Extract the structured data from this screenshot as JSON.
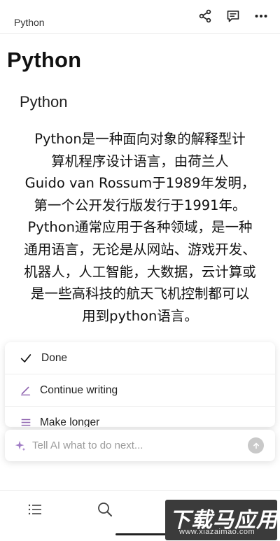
{
  "header": {
    "breadcrumb": "Python",
    "share_icon": "share-icon",
    "comment_icon": "comment-icon",
    "more_icon": "more-icon"
  },
  "document": {
    "title": "Python",
    "heading": "Python",
    "body_lines": [
      "Python是一种面向对象的解释型计",
      "算机程序设计语言，由荷兰人",
      "Guido van Rossum于1989年发明，",
      "第一个公开发行版发行于1991年。",
      "Python通常应用于各种领域，是一种",
      "通用语言，无论是从网站、游戏开发、",
      "机器人，人工智能，大数据，云计算或",
      "是一些高科技的航天飞机控制都可以",
      "用到python语言。"
    ]
  },
  "ai_menu": {
    "items": [
      {
        "label": "Done",
        "icon": "check-icon"
      },
      {
        "label": "Continue writing",
        "icon": "pen-icon"
      },
      {
        "label": "Make longer",
        "icon": "lines-icon"
      }
    ]
  },
  "ai_prompt": {
    "placeholder": "Tell AI what to do next...",
    "icon": "sparkle-icon",
    "send_icon": "send-icon"
  },
  "bottom_nav": {
    "items": [
      "list-icon",
      "search-icon",
      "bell-icon",
      "add-page-icon"
    ]
  },
  "watermark": {
    "title": "下载马应用",
    "url": "www.xiazaimao.com"
  },
  "colors": {
    "accent_purple": "#9065b0",
    "text": "#1a1a1a",
    "placeholder": "#9b9b9b"
  }
}
